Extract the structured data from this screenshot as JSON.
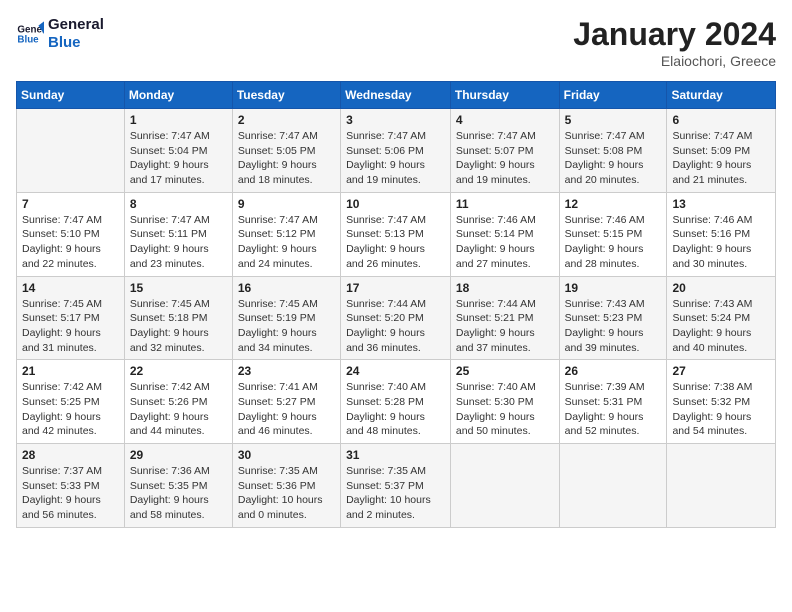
{
  "header": {
    "logo_line1": "General",
    "logo_line2": "Blue",
    "month_title": "January 2024",
    "location": "Elaiochori, Greece"
  },
  "weekdays": [
    "Sunday",
    "Monday",
    "Tuesday",
    "Wednesday",
    "Thursday",
    "Friday",
    "Saturday"
  ],
  "weeks": [
    [
      {
        "day": "",
        "info": ""
      },
      {
        "day": "1",
        "info": "Sunrise: 7:47 AM\nSunset: 5:04 PM\nDaylight: 9 hours\nand 17 minutes."
      },
      {
        "day": "2",
        "info": "Sunrise: 7:47 AM\nSunset: 5:05 PM\nDaylight: 9 hours\nand 18 minutes."
      },
      {
        "day": "3",
        "info": "Sunrise: 7:47 AM\nSunset: 5:06 PM\nDaylight: 9 hours\nand 19 minutes."
      },
      {
        "day": "4",
        "info": "Sunrise: 7:47 AM\nSunset: 5:07 PM\nDaylight: 9 hours\nand 19 minutes."
      },
      {
        "day": "5",
        "info": "Sunrise: 7:47 AM\nSunset: 5:08 PM\nDaylight: 9 hours\nand 20 minutes."
      },
      {
        "day": "6",
        "info": "Sunrise: 7:47 AM\nSunset: 5:09 PM\nDaylight: 9 hours\nand 21 minutes."
      }
    ],
    [
      {
        "day": "7",
        "info": "Sunrise: 7:47 AM\nSunset: 5:10 PM\nDaylight: 9 hours\nand 22 minutes."
      },
      {
        "day": "8",
        "info": "Sunrise: 7:47 AM\nSunset: 5:11 PM\nDaylight: 9 hours\nand 23 minutes."
      },
      {
        "day": "9",
        "info": "Sunrise: 7:47 AM\nSunset: 5:12 PM\nDaylight: 9 hours\nand 24 minutes."
      },
      {
        "day": "10",
        "info": "Sunrise: 7:47 AM\nSunset: 5:13 PM\nDaylight: 9 hours\nand 26 minutes."
      },
      {
        "day": "11",
        "info": "Sunrise: 7:46 AM\nSunset: 5:14 PM\nDaylight: 9 hours\nand 27 minutes."
      },
      {
        "day": "12",
        "info": "Sunrise: 7:46 AM\nSunset: 5:15 PM\nDaylight: 9 hours\nand 28 minutes."
      },
      {
        "day": "13",
        "info": "Sunrise: 7:46 AM\nSunset: 5:16 PM\nDaylight: 9 hours\nand 30 minutes."
      }
    ],
    [
      {
        "day": "14",
        "info": "Sunrise: 7:45 AM\nSunset: 5:17 PM\nDaylight: 9 hours\nand 31 minutes."
      },
      {
        "day": "15",
        "info": "Sunrise: 7:45 AM\nSunset: 5:18 PM\nDaylight: 9 hours\nand 32 minutes."
      },
      {
        "day": "16",
        "info": "Sunrise: 7:45 AM\nSunset: 5:19 PM\nDaylight: 9 hours\nand 34 minutes."
      },
      {
        "day": "17",
        "info": "Sunrise: 7:44 AM\nSunset: 5:20 PM\nDaylight: 9 hours\nand 36 minutes."
      },
      {
        "day": "18",
        "info": "Sunrise: 7:44 AM\nSunset: 5:21 PM\nDaylight: 9 hours\nand 37 minutes."
      },
      {
        "day": "19",
        "info": "Sunrise: 7:43 AM\nSunset: 5:23 PM\nDaylight: 9 hours\nand 39 minutes."
      },
      {
        "day": "20",
        "info": "Sunrise: 7:43 AM\nSunset: 5:24 PM\nDaylight: 9 hours\nand 40 minutes."
      }
    ],
    [
      {
        "day": "21",
        "info": "Sunrise: 7:42 AM\nSunset: 5:25 PM\nDaylight: 9 hours\nand 42 minutes."
      },
      {
        "day": "22",
        "info": "Sunrise: 7:42 AM\nSunset: 5:26 PM\nDaylight: 9 hours\nand 44 minutes."
      },
      {
        "day": "23",
        "info": "Sunrise: 7:41 AM\nSunset: 5:27 PM\nDaylight: 9 hours\nand 46 minutes."
      },
      {
        "day": "24",
        "info": "Sunrise: 7:40 AM\nSunset: 5:28 PM\nDaylight: 9 hours\nand 48 minutes."
      },
      {
        "day": "25",
        "info": "Sunrise: 7:40 AM\nSunset: 5:30 PM\nDaylight: 9 hours\nand 50 minutes."
      },
      {
        "day": "26",
        "info": "Sunrise: 7:39 AM\nSunset: 5:31 PM\nDaylight: 9 hours\nand 52 minutes."
      },
      {
        "day": "27",
        "info": "Sunrise: 7:38 AM\nSunset: 5:32 PM\nDaylight: 9 hours\nand 54 minutes."
      }
    ],
    [
      {
        "day": "28",
        "info": "Sunrise: 7:37 AM\nSunset: 5:33 PM\nDaylight: 9 hours\nand 56 minutes."
      },
      {
        "day": "29",
        "info": "Sunrise: 7:36 AM\nSunset: 5:35 PM\nDaylight: 9 hours\nand 58 minutes."
      },
      {
        "day": "30",
        "info": "Sunrise: 7:35 AM\nSunset: 5:36 PM\nDaylight: 10 hours\nand 0 minutes."
      },
      {
        "day": "31",
        "info": "Sunrise: 7:35 AM\nSunset: 5:37 PM\nDaylight: 10 hours\nand 2 minutes."
      },
      {
        "day": "",
        "info": ""
      },
      {
        "day": "",
        "info": ""
      },
      {
        "day": "",
        "info": ""
      }
    ]
  ]
}
